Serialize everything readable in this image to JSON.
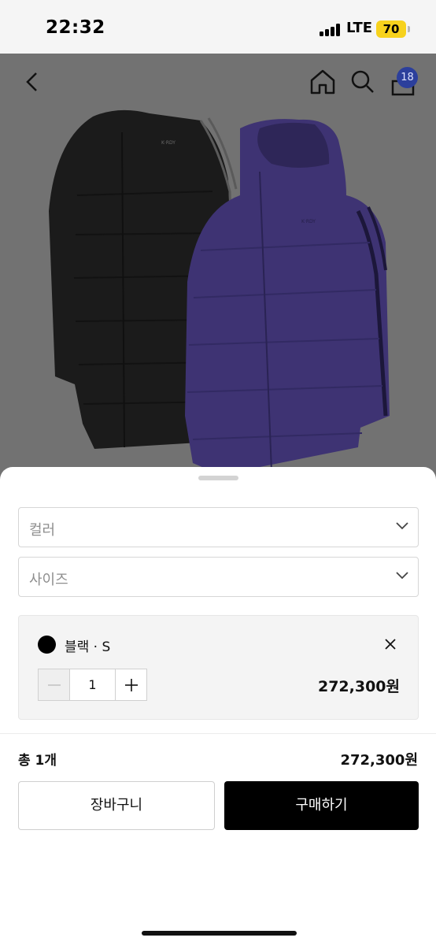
{
  "status_bar": {
    "time": "22:32",
    "network": "LTE",
    "battery": "70"
  },
  "top_nav": {
    "cart_count": "18"
  },
  "options": {
    "color_placeholder": "컬러",
    "size_placeholder": "사이즈"
  },
  "selected_item": {
    "label": "블랙 · S",
    "swatch_color": "#000000",
    "quantity": "1",
    "price": "272,300원"
  },
  "summary": {
    "total_label": "총 1개",
    "total_price": "272,300원"
  },
  "actions": {
    "cart_label": "장바구니",
    "buy_label": "구매하기"
  },
  "colors": {
    "accent": "#000000",
    "badge": "#2c3f9c",
    "battery": "#f7d21d"
  }
}
